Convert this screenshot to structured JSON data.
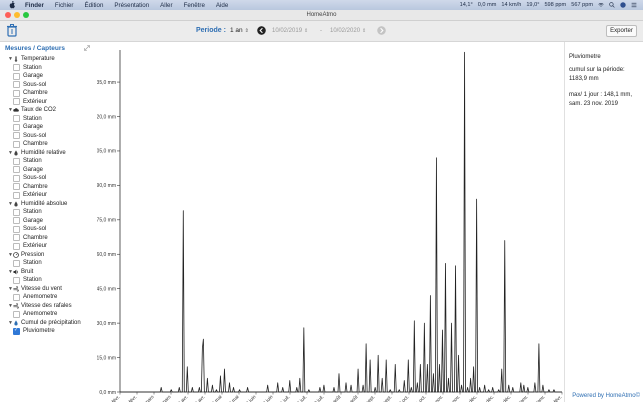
{
  "menubar": {
    "items": [
      "Finder",
      "Fichier",
      "Édition",
      "Présentation",
      "Aller",
      "Fenêtre",
      "Aide"
    ],
    "status": [
      "14,1°",
      "0,0 mm",
      "14 km/h",
      "19,0°",
      "598 ppm",
      "567 ppm"
    ]
  },
  "window": {
    "title": "HomeAtmo"
  },
  "toolbar": {
    "periode_label": "Periode :",
    "periode_value": "1 an",
    "date_from": "10/02/2019",
    "date_sep": "-",
    "date_to": "10/02/2020",
    "export_label": "Exporter"
  },
  "sidebar": {
    "header": "Mesures / Capteurs",
    "categories": [
      {
        "label": "Temperature",
        "icon": "thermometer-icon",
        "children": [
          "Station",
          "Garage",
          "Sous-sol",
          "Chambre",
          "Extérieur"
        ]
      },
      {
        "label": "Taux de CO2",
        "icon": "cloud-icon",
        "children": [
          "Station",
          "Garage",
          "Sous-sol",
          "Chambre"
        ]
      },
      {
        "label": "Humidité relative",
        "icon": "droplet-icon",
        "children": [
          "Station",
          "Garage",
          "Sous-sol",
          "Chambre",
          "Extérieur"
        ]
      },
      {
        "label": "Humidité absolue",
        "icon": "droplet-icon",
        "children": [
          "Station",
          "Garage",
          "Sous-sol",
          "Chambre",
          "Extérieur"
        ]
      },
      {
        "label": "Pression",
        "icon": "gauge-icon",
        "children": [
          "Station"
        ]
      },
      {
        "label": "Bruit",
        "icon": "speaker-icon",
        "children": [
          "Station"
        ]
      },
      {
        "label": "Vitesse du vent",
        "icon": "wind-icon",
        "children": [
          "Anemometre"
        ]
      },
      {
        "label": "Vitesse des rafales",
        "icon": "wind-icon",
        "children": [
          "Anemometre"
        ]
      },
      {
        "label": "Cumul de précipitation",
        "icon": "rain-icon",
        "children": [
          "Pluviometre"
        ],
        "checked": [
          true
        ]
      }
    ]
  },
  "info": {
    "title": "Pluviometre",
    "line1": "cumul sur la période:",
    "line2": "1183,9 mm",
    "line3": "max/ 1 jour : 148,1 mm,",
    "line4": "sam. 23 nov. 2019",
    "powered": "Powered by HomeAtmo©"
  },
  "chart_data": {
    "type": "line",
    "ylabel": "",
    "ylim": [
      0,
      148.1
    ],
    "y_ticks": [
      "0,0 mm",
      "15,0 mm",
      "30,0 mm",
      "45,0 mm",
      "60,0 mm",
      "75,0 mm",
      "90,0 mm",
      "105,0 mm",
      "120,0 mm",
      "135,0 mm"
    ],
    "y_tick_values": [
      0,
      15,
      30,
      45,
      60,
      75,
      90,
      105,
      120,
      135
    ],
    "x_ticks": [
      "11 févr.",
      "25 févr.",
      "11 mars",
      "25 mars",
      "8 avr.",
      "22 avr.",
      "6 mai",
      "20 mai",
      "3 juin",
      "17 juin",
      "1 juil.",
      "15 juil.",
      "29 juil.",
      "12 août",
      "26 août",
      "9 sept.",
      "23 sept.",
      "7 oct.",
      "21 oct.",
      "4 nov.",
      "18 nov.",
      "2 déc.",
      "16 déc.",
      "30 déc.",
      "13 janv.",
      "27 janv.",
      "10 févr."
    ],
    "series": [
      {
        "color": "#222222",
        "points": [
          [
            0,
            0
          ],
          [
            40,
            0
          ],
          [
            41,
            2
          ],
          [
            42,
            0
          ],
          [
            50,
            0
          ],
          [
            51,
            1
          ],
          [
            52,
            0
          ],
          [
            58,
            0
          ],
          [
            59,
            2
          ],
          [
            60,
            0
          ],
          [
            62,
            0
          ],
          [
            63,
            79
          ],
          [
            64,
            0
          ],
          [
            66,
            0
          ],
          [
            67,
            11
          ],
          [
            68,
            0
          ],
          [
            71,
            0
          ],
          [
            72,
            2
          ],
          [
            73,
            0
          ],
          [
            78,
            0
          ],
          [
            79,
            2
          ],
          [
            80,
            0
          ],
          [
            81,
            0
          ],
          [
            82,
            19
          ],
          [
            83,
            23
          ],
          [
            84,
            0
          ],
          [
            86,
            0
          ],
          [
            87,
            6
          ],
          [
            88,
            0
          ],
          [
            91,
            0
          ],
          [
            92,
            3
          ],
          [
            93,
            0
          ],
          [
            95,
            0
          ],
          [
            96,
            1
          ],
          [
            97,
            0
          ],
          [
            99,
            0
          ],
          [
            100,
            7
          ],
          [
            101,
            0
          ],
          [
            103,
            0
          ],
          [
            104,
            10
          ],
          [
            105,
            0
          ],
          [
            108,
            0
          ],
          [
            109,
            4
          ],
          [
            110,
            0
          ],
          [
            112,
            0
          ],
          [
            113,
            2
          ],
          [
            114,
            0
          ],
          [
            118,
            0
          ],
          [
            119,
            1
          ],
          [
            120,
            0
          ],
          [
            126,
            0
          ],
          [
            127,
            2
          ],
          [
            128,
            0
          ],
          [
            146,
            0
          ],
          [
            147,
            3
          ],
          [
            148,
            0
          ],
          [
            156,
            0
          ],
          [
            157,
            4
          ],
          [
            158,
            0
          ],
          [
            161,
            0
          ],
          [
            162,
            2
          ],
          [
            163,
            0
          ],
          [
            168,
            0
          ],
          [
            169,
            5
          ],
          [
            170,
            0
          ],
          [
            175,
            0
          ],
          [
            176,
            2
          ],
          [
            177,
            0
          ],
          [
            178,
            0
          ],
          [
            179,
            6
          ],
          [
            180,
            0
          ],
          [
            182,
            0
          ],
          [
            183,
            28
          ],
          [
            184,
            0
          ],
          [
            187,
            0
          ],
          [
            188,
            1
          ],
          [
            189,
            0
          ],
          [
            198,
            0
          ],
          [
            199,
            2
          ],
          [
            200,
            0
          ],
          [
            202,
            0
          ],
          [
            203,
            3
          ],
          [
            204,
            0
          ],
          [
            212,
            0
          ],
          [
            213,
            2
          ],
          [
            214,
            0
          ],
          [
            217,
            0
          ],
          [
            218,
            8
          ],
          [
            219,
            0
          ],
          [
            224,
            0
          ],
          [
            225,
            4
          ],
          [
            226,
            0
          ],
          [
            229,
            0
          ],
          [
            230,
            3
          ],
          [
            231,
            0
          ],
          [
            236,
            0
          ],
          [
            237,
            10
          ],
          [
            238,
            0
          ],
          [
            241,
            0
          ],
          [
            242,
            3
          ],
          [
            243,
            0
          ],
          [
            244,
            0
          ],
          [
            245,
            21
          ],
          [
            246,
            0
          ],
          [
            248,
            0
          ],
          [
            249,
            14
          ],
          [
            250,
            0
          ],
          [
            253,
            0
          ],
          [
            254,
            2
          ],
          [
            255,
            0
          ],
          [
            256,
            0
          ],
          [
            257,
            16
          ],
          [
            258,
            0
          ],
          [
            260,
            0
          ],
          [
            261,
            6
          ],
          [
            262,
            0
          ],
          [
            264,
            0
          ],
          [
            265,
            14
          ],
          [
            266,
            0
          ],
          [
            268,
            0
          ],
          [
            269,
            1
          ],
          [
            270,
            0
          ],
          [
            273,
            0
          ],
          [
            274,
            12
          ],
          [
            275,
            0
          ],
          [
            277,
            0
          ],
          [
            278,
            1
          ],
          [
            279,
            0
          ],
          [
            282,
            0
          ],
          [
            283,
            5
          ],
          [
            284,
            0
          ],
          [
            286,
            0
          ],
          [
            287,
            14
          ],
          [
            288,
            0
          ],
          [
            289,
            0
          ],
          [
            290,
            2
          ],
          [
            291,
            0
          ],
          [
            292,
            0
          ],
          [
            293,
            31
          ],
          [
            294,
            0
          ],
          [
            295,
            0
          ],
          [
            296,
            4
          ],
          [
            297,
            0
          ],
          [
            298,
            0
          ],
          [
            299,
            12
          ],
          [
            300,
            0
          ],
          [
            302,
            0
          ],
          [
            303,
            30
          ],
          [
            304,
            0
          ],
          [
            305,
            0
          ],
          [
            306,
            12
          ],
          [
            307,
            0
          ],
          [
            308,
            0
          ],
          [
            309,
            42
          ],
          [
            310,
            0
          ],
          [
            311,
            0
          ],
          [
            312,
            8
          ],
          [
            313,
            0
          ],
          [
            314,
            0
          ],
          [
            315,
            102
          ],
          [
            316,
            0
          ],
          [
            317,
            0
          ],
          [
            318,
            12
          ],
          [
            319,
            0
          ],
          [
            320,
            0
          ],
          [
            321,
            27
          ],
          [
            322,
            0
          ],
          [
            323,
            0
          ],
          [
            324,
            56
          ],
          [
            325,
            0
          ],
          [
            326,
            0
          ],
          [
            327,
            6
          ],
          [
            328,
            0
          ],
          [
            329,
            0
          ],
          [
            330,
            30
          ],
          [
            331,
            0
          ],
          [
            333,
            0
          ],
          [
            334,
            55
          ],
          [
            335,
            0
          ],
          [
            336,
            0
          ],
          [
            337,
            16
          ],
          [
            338,
            0
          ],
          [
            339,
            0
          ],
          [
            340,
            3
          ],
          [
            341,
            0
          ],
          [
            342,
            0
          ],
          [
            343,
            148
          ],
          [
            344,
            0
          ],
          [
            345,
            0
          ],
          [
            346,
            2
          ],
          [
            347,
            0
          ],
          [
            348,
            0
          ],
          [
            349,
            6
          ],
          [
            350,
            0
          ],
          [
            351,
            0
          ],
          [
            352,
            11
          ],
          [
            353,
            0
          ],
          [
            354,
            0
          ],
          [
            355,
            84
          ],
          [
            356,
            0
          ],
          [
            357,
            0
          ],
          [
            358,
            2
          ],
          [
            359,
            0
          ],
          [
            362,
            0
          ],
          [
            363,
            3
          ],
          [
            364,
            0
          ],
          [
            366,
            0
          ],
          [
            367,
            1
          ],
          [
            368,
            0
          ],
          [
            370,
            0
          ],
          [
            371,
            2
          ],
          [
            372,
            0
          ],
          [
            376,
            0
          ],
          [
            377,
            1
          ],
          [
            378,
            0
          ],
          [
            379,
            0
          ],
          [
            380,
            10
          ],
          [
            381,
            0
          ],
          [
            382,
            0
          ],
          [
            383,
            66
          ],
          [
            384,
            0
          ],
          [
            386,
            0
          ],
          [
            387,
            3
          ],
          [
            388,
            0
          ],
          [
            390,
            0
          ],
          [
            391,
            2
          ],
          [
            392,
            0
          ],
          [
            398,
            0
          ],
          [
            399,
            4
          ],
          [
            400,
            0
          ],
          [
            401,
            0
          ],
          [
            402,
            3
          ],
          [
            403,
            0
          ],
          [
            405,
            0
          ],
          [
            406,
            2
          ],
          [
            407,
            0
          ],
          [
            412,
            0
          ],
          [
            413,
            4
          ],
          [
            414,
            0
          ],
          [
            416,
            0
          ],
          [
            417,
            21
          ],
          [
            418,
            0
          ],
          [
            420,
            0
          ],
          [
            421,
            3
          ],
          [
            422,
            0
          ],
          [
            426,
            0
          ],
          [
            427,
            1
          ],
          [
            428,
            0
          ],
          [
            431,
            0
          ],
          [
            432,
            1
          ],
          [
            433,
            0
          ],
          [
            440,
            0
          ]
        ]
      }
    ],
    "grid": false,
    "legend": "none"
  }
}
